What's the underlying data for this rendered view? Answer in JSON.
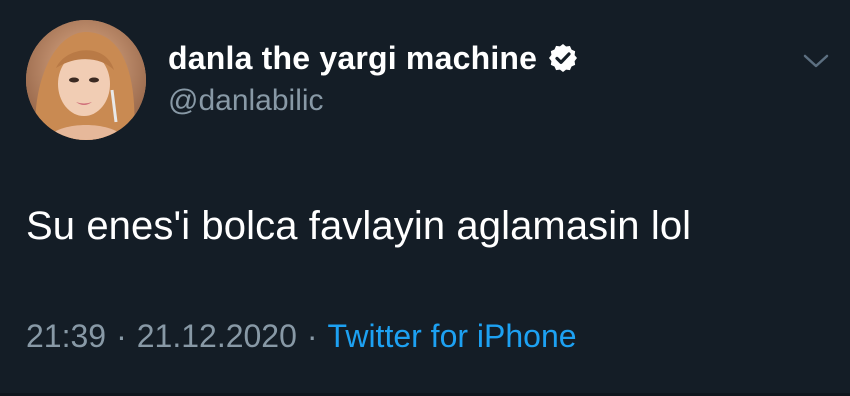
{
  "tweet": {
    "author": {
      "display_name": "danla the yargi machine",
      "handle": "@danlabilic",
      "verified": true
    },
    "text": "Su enes'i bolca favlayin aglamasin lol",
    "time": "21:39",
    "date": "21.12.2020",
    "separator": "·",
    "source": "Twitter for iPhone"
  },
  "icons": {
    "avatar": "profile-photo",
    "verified": "verified-badge-icon",
    "menu": "chevron-down-icon"
  },
  "colors": {
    "background": "#141d26",
    "primary_text": "#ffffff",
    "secondary_text": "#8899a6",
    "link": "#1da1f2"
  }
}
